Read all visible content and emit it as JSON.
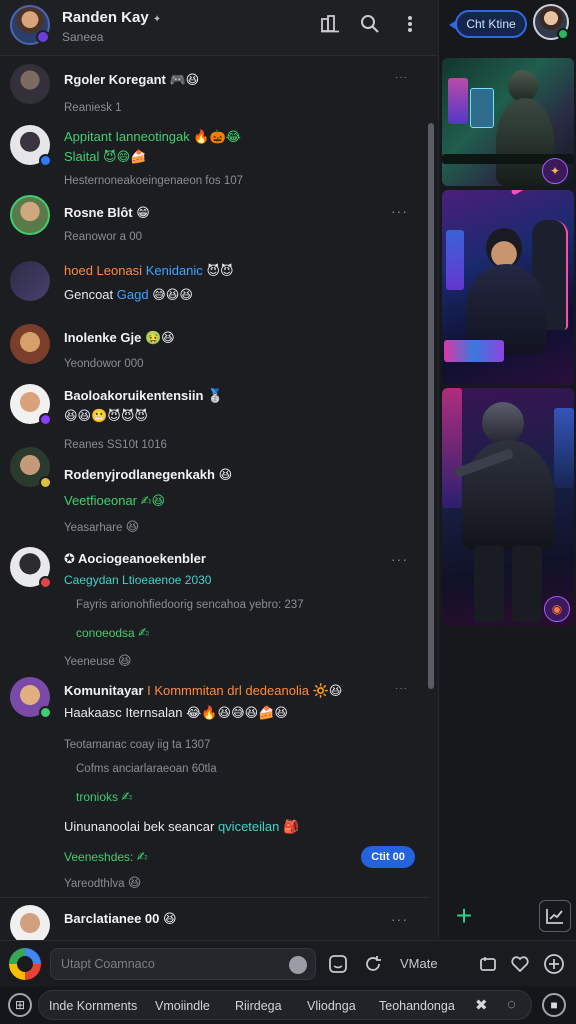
{
  "header": {
    "title": "Randen Kay",
    "title_badge": "✦",
    "subtitle": "Saneea"
  },
  "right_panel": {
    "chat_pill": "Cht Ktine",
    "thumb_badge": "✦",
    "thumb_badge_bottom": "◉"
  },
  "feed": {
    "items": [
      {
        "line1": "Rgoler Koregant",
        "emoji1": "🎮😆",
        "line2": "Reaniesk 1"
      },
      {
        "line1": "Appitant Ianneotingak",
        "emoji1": "🔥🎃😂",
        "line2": "Slaital",
        "emoji2": "😈😄🍰",
        "line3": "Hesternoneakoeingenaeon fos 107"
      },
      {
        "line1": "Rosne Blôt",
        "emoji1": "😁",
        "line2": "Reanowor a 00"
      },
      {
        "line1": "hoed Leonasi",
        "line1b": "Kenidanic",
        "emoji1": "😈😈",
        "line2": "Gencoat",
        "line2b": "Gagd",
        "emoji2": "😅😆😆"
      },
      {
        "line1": "Inolenke Gje",
        "emoji1": "🤢😆",
        "line2": "Yeondowor 000"
      },
      {
        "line1": "Baoloakoruikentensiin",
        "emoji1": "🥈",
        "emoji2": "😆😆😬😈😈😈"
      },
      {
        "line1": "Reanes SS10t 1016",
        "line2": "Rodenyjrodlanegenkakh",
        "emoji2": "😆",
        "line3": "Veetfioeonar",
        "emoji3": "✍😆",
        "line4": "Yeasarhare",
        "emoji4": "😆"
      },
      {
        "line1": "Aociogeanoekenbler",
        "line2": "Caegydan Ltioeaenoe 2030",
        "line3": "Fayris arionohfiedoorig sencahoa yebro: 237",
        "line4": "conoeodsa",
        "emoji4": "✍",
        "line5": "Yeeneuse",
        "emoji5": "😆"
      },
      {
        "line1": "Komunitayar",
        "line1b": "I Kommmitan drl dedeanolia",
        "emoji1": "🔆😆",
        "line2": "Haakaasc Iternsalan",
        "emoji2": "😂🔥😆😅😆🍰😆",
        "line3": "Teotamanac coay iig ta 1307",
        "line4": "Cofms anciarlaraeoan 60tla",
        "line5": "tronioks",
        "emoji5": "✍",
        "line6": "Uinunanoolai bek seancar",
        "line6b": "qviceteilan",
        "emoji6": "🎒",
        "line7": "Veeneshdes:",
        "emoji7": "✍",
        "line8": "Yareodthlva",
        "emoji8": "😆"
      },
      {
        "line1": "Barclatianee 00",
        "emoji1": "😆"
      }
    ],
    "more_label": "···",
    "reply_label": "Ctit 00"
  },
  "composer": {
    "placeholder": "Utapt Coamnaco",
    "label": "VMate"
  },
  "bottom_tabs": [
    "Inde Kornments",
    "Vmoiindle",
    "Riirdega",
    "Vliodnga",
    "Teohandonga"
  ],
  "colors": {
    "accent_blue": "#2463de",
    "green": "#3fcf6f",
    "orange": "#ff8a3c",
    "background": "#1c1d21"
  }
}
